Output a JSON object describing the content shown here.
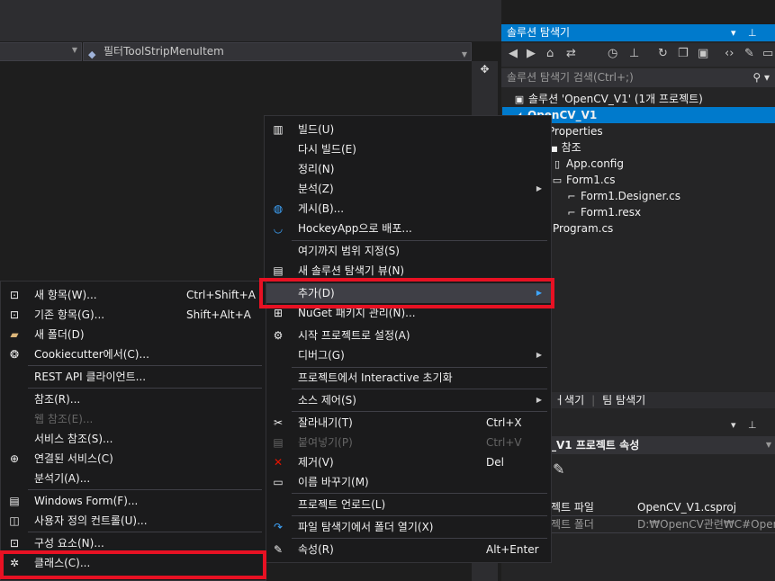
{
  "editor": {
    "dropdown_right": "필터ToolStripMenuItem",
    "split_icon": "splitter-icon"
  },
  "solution_explorer": {
    "title": "솔루션 탐색기",
    "title_icons": "▾ ⊥ ✕",
    "search_placeholder": "솔루션 탐색기 검색(Ctrl+;)",
    "tree": [
      {
        "label": "솔루션 'OpenCV_V1' (1개 프로젝트)",
        "icon": "solution-icon"
      },
      {
        "label": "OpenCV_V1",
        "icon": "csharp-project-icon",
        "selected": true
      },
      {
        "label": "Properties",
        "icon": "wrench-icon"
      },
      {
        "label": "참조",
        "icon": "references-icon"
      },
      {
        "label": "App.config",
        "icon": "config-file-icon"
      },
      {
        "label": "Form1.cs",
        "icon": "form-icon"
      },
      {
        "label": "Form1.Designer.cs",
        "icon": "csharp-file-icon"
      },
      {
        "label": "Form1.resx",
        "icon": "resource-file-icon"
      },
      {
        "label": "Program.cs",
        "icon": "csharp-file-icon"
      }
    ],
    "tabs": [
      "ㅓ색기",
      "팀 탐색기"
    ]
  },
  "properties": {
    "title_icons": "▾ ⊥ ✕",
    "object": "_V1 프로젝트 속성",
    "rows": [
      {
        "name": "젝트 파일",
        "value": "OpenCV_V1.csproj"
      },
      {
        "name": "젝트 폴더",
        "value": "D:₩OpenCV관련₩C#OpenCV"
      }
    ]
  },
  "context_menu": {
    "items": [
      {
        "icon": "build-icon",
        "label": "빌드(U)"
      },
      {
        "label": "다시 빌드(E)"
      },
      {
        "label": "정리(N)"
      },
      {
        "label": "분석(Z)",
        "submenu": true
      },
      {
        "icon": "globe-icon",
        "label": "게시(B)..."
      },
      {
        "icon": "hockeyapp-icon",
        "label": "HockeyApp으로 배포..."
      },
      {
        "label": "여기까지 범위 지정(S)"
      },
      {
        "icon": "new-view-icon",
        "label": "새 솔루션 탐색기 뷰(N)"
      },
      {
        "label": "추가(D)",
        "submenu": true,
        "highlighted": true
      },
      {
        "icon": "nuget-icon",
        "label": "NuGet 패키지 관리(N)..."
      },
      {
        "icon": "gear-icon",
        "label": "시작 프로젝트로 설정(A)"
      },
      {
        "label": "디버그(G)",
        "submenu": true
      },
      {
        "label": "프로젝트에서 Interactive 초기화"
      },
      {
        "label": "소스 제어(S)",
        "submenu": true
      },
      {
        "icon": "scissors-icon",
        "label": "잘라내기(T)",
        "shortcut": "Ctrl+X"
      },
      {
        "icon": "paste-icon",
        "label": "붙여넣기(P)",
        "shortcut": "Ctrl+V",
        "disabled": true
      },
      {
        "icon": "delete-icon",
        "label": "제거(V)",
        "shortcut": "Del"
      },
      {
        "icon": "rename-icon",
        "label": "이름 바꾸기(M)"
      },
      {
        "label": "프로젝트 언로드(L)"
      },
      {
        "icon": "open-folder-icon",
        "label": "파일 탐색기에서 폴더 열기(X)"
      },
      {
        "icon": "wrench-icon",
        "label": "속성(R)",
        "shortcut": "Alt+Enter"
      }
    ]
  },
  "submenu": {
    "items": [
      {
        "icon": "new-item-icon",
        "label": "새 항목(W)...",
        "shortcut": "Ctrl+Shift+A"
      },
      {
        "icon": "existing-item-icon",
        "label": "기존 항목(G)...",
        "shortcut": "Shift+Alt+A"
      },
      {
        "icon": "new-folder-icon",
        "label": "새 폴더(D)"
      },
      {
        "icon": "cookiecutter-icon",
        "label": "Cookiecutter에서(C)..."
      },
      {
        "label": "REST API 클라이언트..."
      },
      {
        "label": "참조(R)..."
      },
      {
        "label": "웹 참조(E)...",
        "disabled": true
      },
      {
        "label": "서비스 참조(S)..."
      },
      {
        "icon": "connected-service-icon",
        "label": "연결된 서비스(C)"
      },
      {
        "label": "분석기(A)..."
      },
      {
        "icon": "windows-form-icon",
        "label": "Windows Form(F)..."
      },
      {
        "icon": "user-control-icon",
        "label": "사용자 정의 컨트롤(U)..."
      },
      {
        "icon": "component-icon",
        "label": "구성 요소(N)..."
      },
      {
        "icon": "class-icon",
        "label": "클래스(C)..."
      }
    ]
  },
  "colors": {
    "accent": "#007acc",
    "highlight_box": "#e81123"
  }
}
